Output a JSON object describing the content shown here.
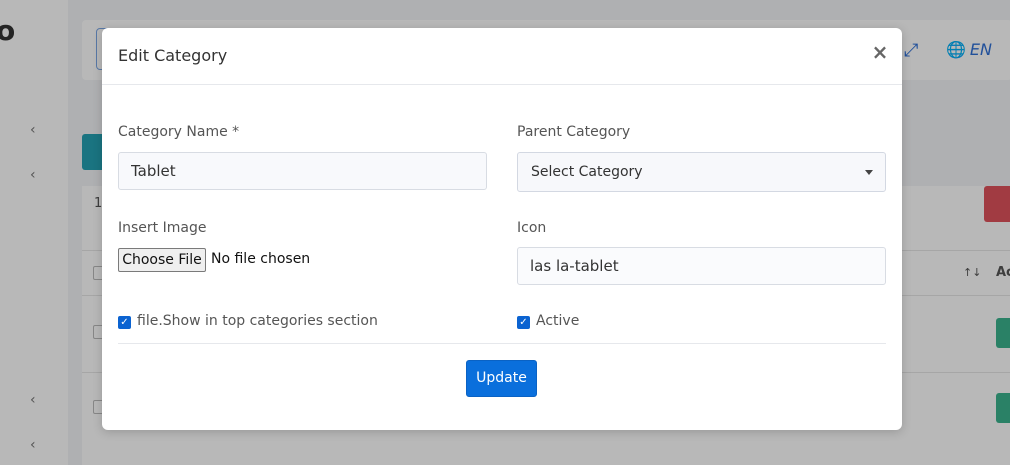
{
  "modal": {
    "title": "Edit Category",
    "close_glyph": "×",
    "fields": {
      "category_name": {
        "label": "Category Name *",
        "value": "Tablet"
      },
      "parent_category": {
        "label": "Parent Category",
        "selected": "Select Category"
      },
      "insert_image": {
        "label": "Insert Image",
        "button": "Choose File",
        "status": "No file chosen"
      },
      "icon": {
        "label": "Icon",
        "value": "las la-tablet"
      }
    },
    "checkboxes": {
      "top_categories": {
        "label": "file.Show in top categories section",
        "checked": true
      },
      "active": {
        "label": "Active",
        "checked": true
      }
    },
    "submit_label": "Update"
  },
  "background": {
    "logo_fragment": "o",
    "language": "EN",
    "pagination_fragment": "1",
    "column_fragment": "Ac",
    "sort_glyph": "↑↓"
  },
  "colors": {
    "primary": "#0a6fdc",
    "checkbox": "#0b63d1",
    "overlay": "rgba(0,0,0,0.28)"
  },
  "icons": {
    "close": "close-icon",
    "caret": "chevron-down-icon",
    "check": "checkmark-icon",
    "globe": "globe-icon",
    "expand": "fullscreen-icon"
  }
}
